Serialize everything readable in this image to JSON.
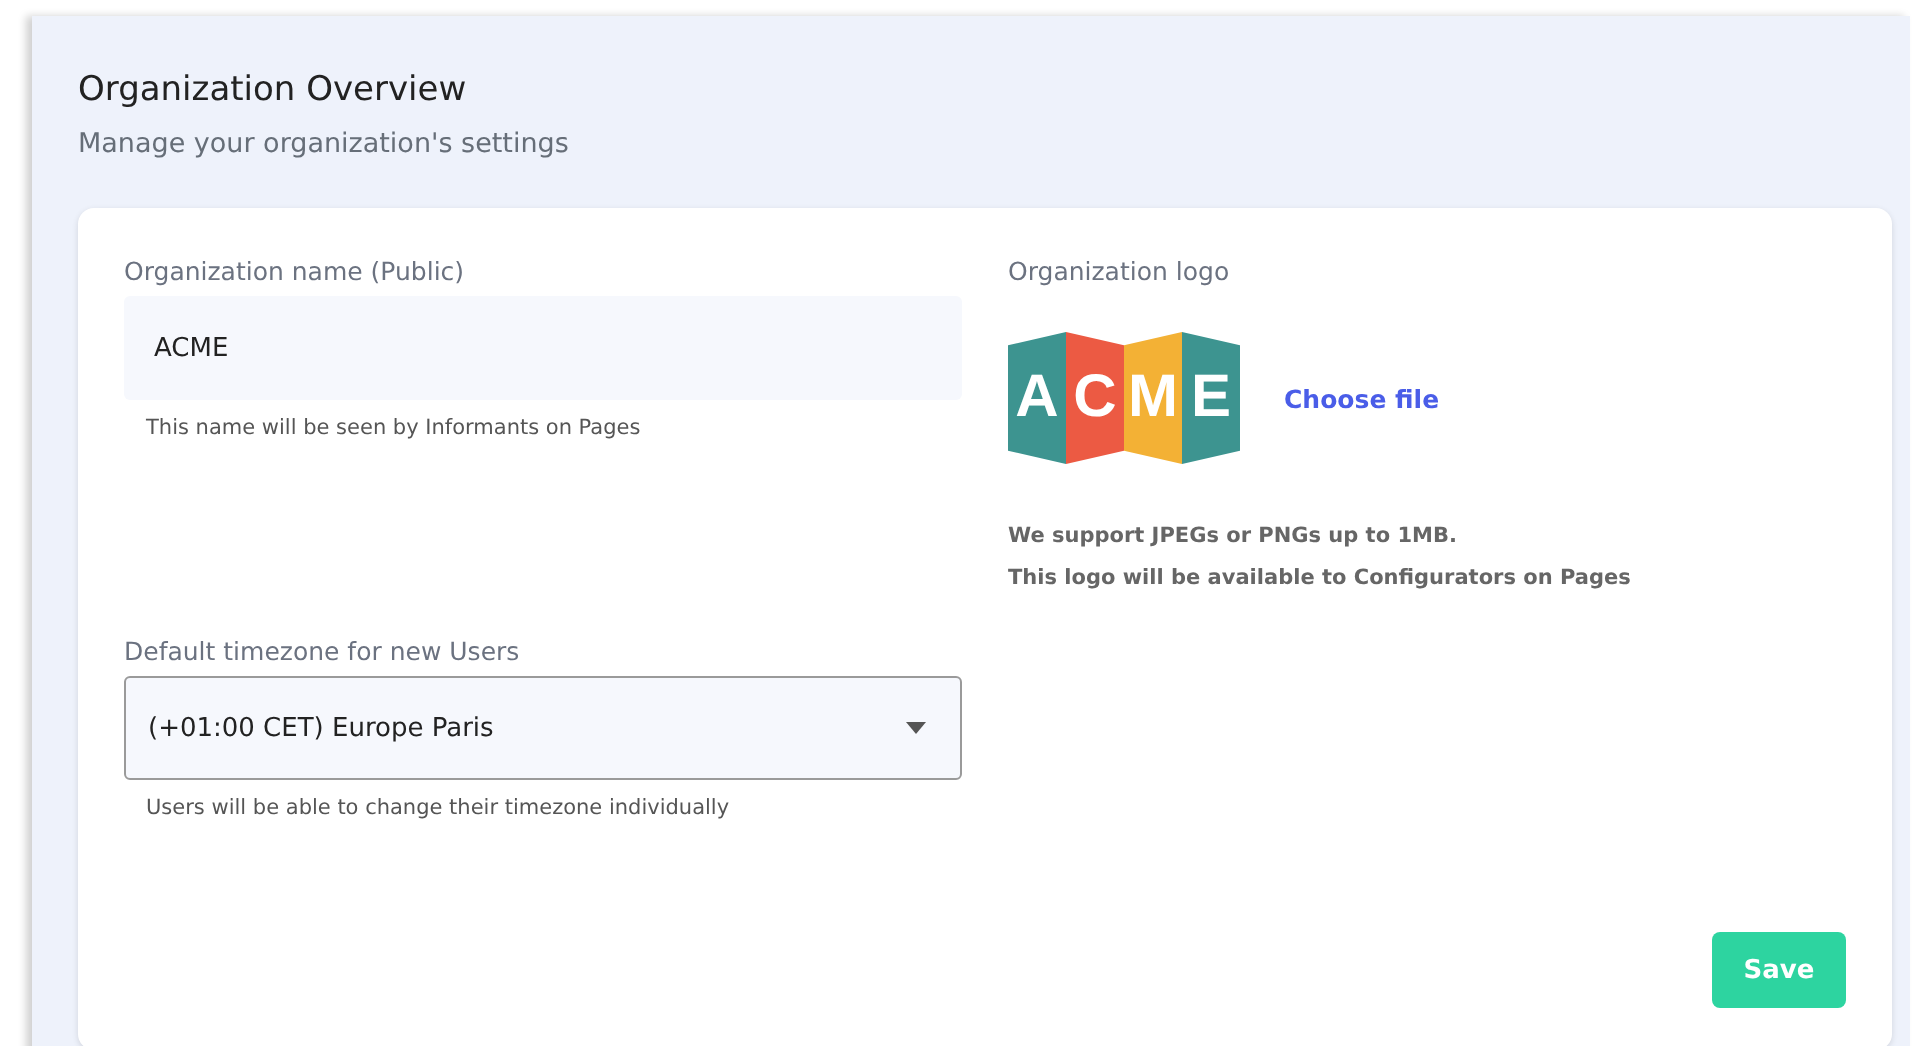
{
  "header": {
    "title": "Organization Overview",
    "subtitle": "Manage your organization's settings"
  },
  "name_field": {
    "label": "Organization name (Public)",
    "value": "ACME",
    "hint": "This name will be seen by Informants on Pages"
  },
  "logo": {
    "label": "Organization logo",
    "letters": "ACME",
    "choose_file": "Choose file",
    "notes": [
      "We support JPEGs or PNGs up to 1MB.",
      "This logo will be available to Configurators on Pages"
    ]
  },
  "timezone": {
    "label": "Default timezone for new Users",
    "value": "(+01:00 CET) Europe Paris",
    "hint": "Users will be able to change their timezone individually"
  },
  "buttons": [
    "Save"
  ]
}
